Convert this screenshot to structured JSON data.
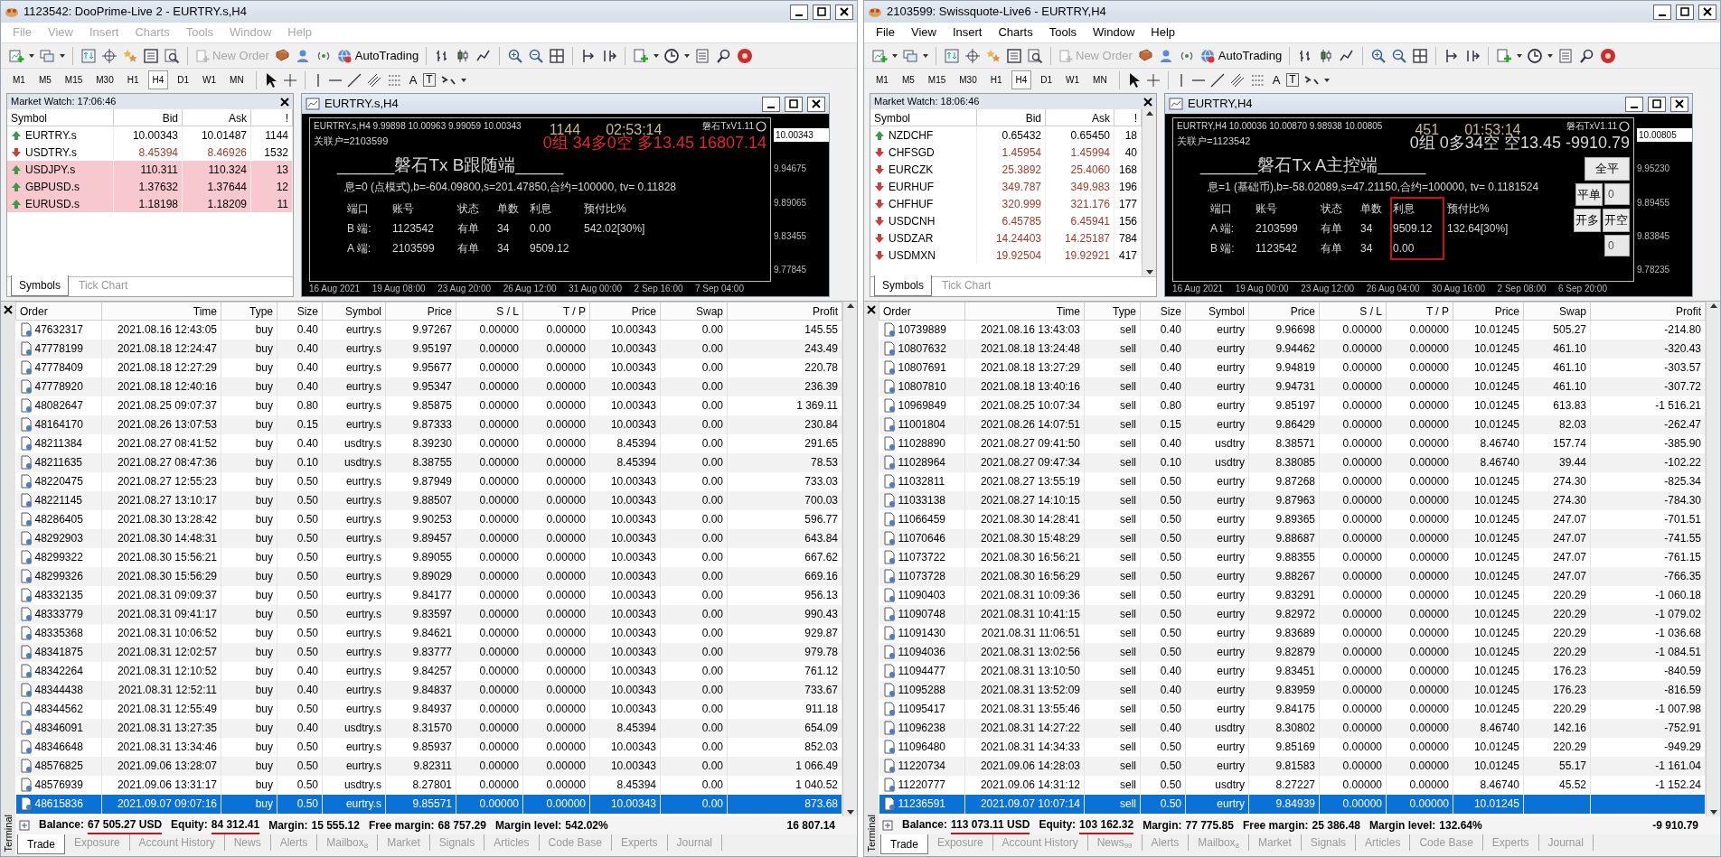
{
  "windows": [
    {
      "title": "1123542: DooPrime-Live 2 - EURTRY.s,H4",
      "active": false,
      "menu": [
        "File",
        "View",
        "Insert",
        "Charts",
        "Tools",
        "Window",
        "Help"
      ],
      "toolbar": {
        "new_order": {
          "label": "New Order",
          "disabled": true
        },
        "autotrading": "AutoTrading",
        "text_tool": "A",
        "label_tool": "T"
      },
      "timeframes": [
        {
          "label": "M1",
          "selected": false
        },
        {
          "label": "M5",
          "selected": false
        },
        {
          "label": "M15",
          "selected": false
        },
        {
          "label": "M30",
          "selected": false
        },
        {
          "label": "H1",
          "selected": false
        },
        {
          "label": "H4",
          "selected": true
        },
        {
          "label": "D1",
          "selected": false
        },
        {
          "label": "W1",
          "selected": false
        },
        {
          "label": "MN",
          "selected": false
        }
      ],
      "market_watch": {
        "title": "Market Watch: 17:06:46",
        "columns": [
          "Symbol",
          "Bid",
          "Ask",
          "!"
        ],
        "rows": [
          {
            "symbol": "EURTRY.s",
            "bid": "10.00343",
            "ask": "10.01487",
            "spread": "1144",
            "rising": true,
            "highlighted": false
          },
          {
            "symbol": "USDTRY.s",
            "bid": "8.45394",
            "ask": "8.46926",
            "spread": "1532",
            "rising": false,
            "highlighted": false
          },
          {
            "symbol": "USDJPY.s",
            "bid": "110.311",
            "ask": "110.324",
            "spread": "13",
            "rising": true,
            "highlighted": true
          },
          {
            "symbol": "GBPUSD.s",
            "bid": "1.37632",
            "ask": "1.37644",
            "spread": "12",
            "rising": true,
            "highlighted": true
          },
          {
            "symbol": "EURUSD.s",
            "bid": "1.18198",
            "ask": "1.18209",
            "spread": "11",
            "rising": true,
            "highlighted": true
          }
        ],
        "tabs": [
          {
            "label": "Symbols",
            "selected": true
          },
          {
            "label": "Tick Chart",
            "selected": false
          }
        ]
      },
      "chart": {
        "title": "EURTRY.s,H4",
        "ohlc": "EURTRY.s,H4  9.99898 10.00963 9.99059 10.00343",
        "linked": "关联户=2103599",
        "counter": "1144",
        "timer": "02:53:14",
        "version": "磐石TxV1.11",
        "summary": {
          "text": "0组 34多0空 多13.45 16807.14",
          "color": "#e0252d"
        },
        "panel": {
          "title": "______磐石Tx B跟随端_____",
          "info": "息=0 (点模式),b=-604.09800,s=201.47850,合约=100000, tv= 0.11828",
          "columns": [
            {
              "label": "端口",
              "boxed": false
            },
            {
              "label": "账号",
              "boxed": false
            },
            {
              "label": "状态",
              "boxed": false
            },
            {
              "label": "单数",
              "boxed": false
            },
            {
              "label": "利息",
              "boxed": false
            },
            {
              "label": "预付比%",
              "boxed": false
            }
          ],
          "rows": [
            [
              "B 端:",
              "1123542",
              "有单",
              "34",
              "0.00",
              "542.02[30%]"
            ],
            [
              "A 端:",
              "2103599",
              "有单",
              "34",
              "9509.12"
            ]
          ]
        },
        "price_scale": [
          {
            "label": "10.00343",
            "current": true
          },
          {
            "label": "9.94675",
            "current": false
          },
          {
            "label": "9.89065",
            "current": false
          },
          {
            "label": "9.83455",
            "current": false
          },
          {
            "label": "9.77845",
            "current": false
          }
        ],
        "time_axis": [
          "16 Aug 2021",
          "19 Aug 08:00",
          "23 Aug 20:00",
          "26 Aug 12:00",
          "31 Aug 00:00",
          "2 Sep 16:00",
          "7 Sep 04:00"
        ]
      },
      "terminal": {
        "label": "Terminal",
        "columns": [
          "Order",
          "Time",
          "Type",
          "Size",
          "Symbol",
          "Price",
          "S / L",
          "T / P",
          "Price",
          "Swap",
          "Profit"
        ],
        "rows": [
          {
            "cells": [
              "47632317",
              "2021.08.16 12:43:05",
              "buy",
              "0.40",
              "eurtry.s",
              "9.97267",
              "0.00000",
              "0.00000",
              "10.00343",
              "0.00",
              "145.55"
            ],
            "selected": false
          },
          {
            "cells": [
              "47778199",
              "2021.08.18 12:24:47",
              "buy",
              "0.40",
              "eurtry.s",
              "9.95197",
              "0.00000",
              "0.00000",
              "10.00343",
              "0.00",
              "243.49"
            ],
            "selected": false
          },
          {
            "cells": [
              "47778409",
              "2021.08.18 12:27:29",
              "buy",
              "0.40",
              "eurtry.s",
              "9.95677",
              "0.00000",
              "0.00000",
              "10.00343",
              "0.00",
              "220.78"
            ],
            "selected": false
          },
          {
            "cells": [
              "47778920",
              "2021.08.18 12:40:16",
              "buy",
              "0.40",
              "eurtry.s",
              "9.95347",
              "0.00000",
              "0.00000",
              "10.00343",
              "0.00",
              "236.39"
            ],
            "selected": false
          },
          {
            "cells": [
              "48082647",
              "2021.08.25 09:07:37",
              "buy",
              "0.80",
              "eurtry.s",
              "9.85875",
              "0.00000",
              "0.00000",
              "10.00343",
              "0.00",
              "1 369.11"
            ],
            "selected": false
          },
          {
            "cells": [
              "48164170",
              "2021.08.26 13:07:53",
              "buy",
              "0.15",
              "eurtry.s",
              "9.87333",
              "0.00000",
              "0.00000",
              "10.00343",
              "0.00",
              "230.84"
            ],
            "selected": false
          },
          {
            "cells": [
              "48211384",
              "2021.08.27 08:41:52",
              "buy",
              "0.40",
              "usdtry.s",
              "8.39230",
              "0.00000",
              "0.00000",
              "8.45394",
              "0.00",
              "291.65"
            ],
            "selected": false
          },
          {
            "cells": [
              "48211635",
              "2021.08.27 08:47:36",
              "buy",
              "0.10",
              "usdtry.s",
              "8.38755",
              "0.00000",
              "0.00000",
              "8.45394",
              "0.00",
              "78.53"
            ],
            "selected": false
          },
          {
            "cells": [
              "48220475",
              "2021.08.27 12:55:23",
              "buy",
              "0.50",
              "eurtry.s",
              "9.87949",
              "0.00000",
              "0.00000",
              "10.00343",
              "0.00",
              "733.03"
            ],
            "selected": false
          },
          {
            "cells": [
              "48221145",
              "2021.08.27 13:10:17",
              "buy",
              "0.50",
              "eurtry.s",
              "9.88507",
              "0.00000",
              "0.00000",
              "10.00343",
              "0.00",
              "700.03"
            ],
            "selected": false
          },
          {
            "cells": [
              "48286405",
              "2021.08.30 13:28:42",
              "buy",
              "0.50",
              "eurtry.s",
              "9.90253",
              "0.00000",
              "0.00000",
              "10.00343",
              "0.00",
              "596.77"
            ],
            "selected": false
          },
          {
            "cells": [
              "48292903",
              "2021.08.30 14:48:31",
              "buy",
              "0.50",
              "eurtry.s",
              "9.89457",
              "0.00000",
              "0.00000",
              "10.00343",
              "0.00",
              "643.84"
            ],
            "selected": false
          },
          {
            "cells": [
              "48299322",
              "2021.08.30 15:56:21",
              "buy",
              "0.50",
              "eurtry.s",
              "9.89055",
              "0.00000",
              "0.00000",
              "10.00343",
              "0.00",
              "667.62"
            ],
            "selected": false
          },
          {
            "cells": [
              "48299326",
              "2021.08.30 15:56:29",
              "buy",
              "0.50",
              "eurtry.s",
              "9.89029",
              "0.00000",
              "0.00000",
              "10.00343",
              "0.00",
              "669.16"
            ],
            "selected": false
          },
          {
            "cells": [
              "48332135",
              "2021.08.31 09:09:37",
              "buy",
              "0.50",
              "eurtry.s",
              "9.84177",
              "0.00000",
              "0.00000",
              "10.00343",
              "0.00",
              "956.13"
            ],
            "selected": false
          },
          {
            "cells": [
              "48333779",
              "2021.08.31 09:41:17",
              "buy",
              "0.50",
              "eurtry.s",
              "9.83597",
              "0.00000",
              "0.00000",
              "10.00343",
              "0.00",
              "990.43"
            ],
            "selected": false
          },
          {
            "cells": [
              "48335368",
              "2021.08.31 10:06:52",
              "buy",
              "0.50",
              "eurtry.s",
              "9.84621",
              "0.00000",
              "0.00000",
              "10.00343",
              "0.00",
              "929.87"
            ],
            "selected": false
          },
          {
            "cells": [
              "48341875",
              "2021.08.31 12:02:57",
              "buy",
              "0.50",
              "eurtry.s",
              "9.83777",
              "0.00000",
              "0.00000",
              "10.00343",
              "0.00",
              "979.78"
            ],
            "selected": false
          },
          {
            "cells": [
              "48342264",
              "2021.08.31 12:10:52",
              "buy",
              "0.40",
              "eurtry.s",
              "9.84257",
              "0.00000",
              "0.00000",
              "10.00343",
              "0.00",
              "761.12"
            ],
            "selected": false
          },
          {
            "cells": [
              "48344438",
              "2021.08.31 12:52:11",
              "buy",
              "0.40",
              "eurtry.s",
              "9.84837",
              "0.00000",
              "0.00000",
              "10.00343",
              "0.00",
              "733.67"
            ],
            "selected": false
          },
          {
            "cells": [
              "48344562",
              "2021.08.31 12:55:49",
              "buy",
              "0.50",
              "eurtry.s",
              "9.84937",
              "0.00000",
              "0.00000",
              "10.00343",
              "0.00",
              "911.18"
            ],
            "selected": false
          },
          {
            "cells": [
              "48346091",
              "2021.08.31 13:27:35",
              "buy",
              "0.40",
              "usdtry.s",
              "8.31570",
              "0.00000",
              "0.00000",
              "8.45394",
              "0.00",
              "654.09"
            ],
            "selected": false
          },
          {
            "cells": [
              "48346648",
              "2021.08.31 13:34:46",
              "buy",
              "0.50",
              "eurtry.s",
              "9.85937",
              "0.00000",
              "0.00000",
              "10.00343",
              "0.00",
              "852.03"
            ],
            "selected": false
          },
          {
            "cells": [
              "48576825",
              "2021.09.06 13:28:07",
              "buy",
              "0.50",
              "eurtry.s",
              "9.82311",
              "0.00000",
              "0.00000",
              "10.00343",
              "0.00",
              "1 066.49"
            ],
            "selected": false
          },
          {
            "cells": [
              "48576939",
              "2021.09.06 13:31:17",
              "buy",
              "0.50",
              "usdtry.s",
              "8.27801",
              "0.00000",
              "0.00000",
              "8.45394",
              "0.00",
              "1 040.52"
            ],
            "selected": false
          },
          {
            "cells": [
              "48615836",
              "2021.09.07 09:07:16",
              "buy",
              "0.50",
              "eurtry.s",
              "9.85571",
              "0.00000",
              "0.00000",
              "10.00343",
              "0.00",
              "873.68"
            ],
            "selected": true
          }
        ],
        "summary": [
          {
            "label": "Balance:",
            "value": "67 505.27 USD",
            "underlined": true
          },
          {
            "label": "Equity:",
            "value": "84 312.41",
            "underlined": true
          },
          {
            "label": "Margin:",
            "value": "15 555.12",
            "underlined": false
          },
          {
            "label": "Free margin:",
            "value": "68 757.29",
            "underlined": false
          },
          {
            "label": "Margin level:",
            "value": "542.02%",
            "underlined": false
          }
        ],
        "total": "16 807.14",
        "tabs": [
          {
            "label": "Trade",
            "selected": true
          },
          {
            "label": "Exposure",
            "selected": false
          },
          {
            "label": "Account History",
            "selected": false
          },
          {
            "label": "News",
            "selected": false
          },
          {
            "label": "Alerts",
            "selected": false
          },
          {
            "label": "Mailbox$_{8}$",
            "selected": false
          },
          {
            "label": "Market",
            "selected": false
          },
          {
            "label": "Signals",
            "selected": false
          },
          {
            "label": "Articles",
            "selected": false
          },
          {
            "label": "Code Base",
            "selected": false
          },
          {
            "label": "Experts",
            "selected": false
          },
          {
            "label": "Journal",
            "selected": false
          }
        ]
      }
    },
    {
      "title": "2103599: Swissquote-Live6 - EURTRY,H4",
      "active": true,
      "menu": [
        "File",
        "View",
        "Insert",
        "Charts",
        "Tools",
        "Window",
        "Help"
      ],
      "toolbar": {
        "new_order": {
          "label": "New Order",
          "disabled": true
        },
        "autotrading": "AutoTrading",
        "text_tool": "A",
        "label_tool": "T"
      },
      "timeframes": [
        {
          "label": "M1",
          "selected": false
        },
        {
          "label": "M5",
          "selected": false
        },
        {
          "label": "M15",
          "selected": false
        },
        {
          "label": "M30",
          "selected": false
        },
        {
          "label": "H1",
          "selected": false
        },
        {
          "label": "H4",
          "selected": true
        },
        {
          "label": "D1",
          "selected": false
        },
        {
          "label": "W1",
          "selected": false
        },
        {
          "label": "MN",
          "selected": false
        }
      ],
      "market_watch": {
        "title": "Market Watch: 18:06:46",
        "columns": [
          "Symbol",
          "Bid",
          "Ask",
          "!"
        ],
        "scrollbar": true,
        "rows": [
          {
            "symbol": "NZDCHF",
            "bid": "0.65432",
            "ask": "0.65450",
            "spread": "18",
            "rising": true,
            "highlighted": false
          },
          {
            "symbol": "CHFSGD",
            "bid": "1.45954",
            "ask": "1.45994",
            "spread": "40",
            "rising": false,
            "highlighted": false
          },
          {
            "symbol": "EURCZK",
            "bid": "25.3892",
            "ask": "25.4060",
            "spread": "168",
            "rising": false,
            "highlighted": false
          },
          {
            "symbol": "EURHUF",
            "bid": "349.787",
            "ask": "349.983",
            "spread": "196",
            "rising": false,
            "highlighted": false
          },
          {
            "symbol": "CHFHUF",
            "bid": "320.999",
            "ask": "321.176",
            "spread": "177",
            "rising": false,
            "highlighted": false
          },
          {
            "symbol": "USDCNH",
            "bid": "6.45785",
            "ask": "6.45941",
            "spread": "156",
            "rising": false,
            "highlighted": false
          },
          {
            "symbol": "USDZAR",
            "bid": "14.24403",
            "ask": "14.25187",
            "spread": "784",
            "rising": false,
            "highlighted": false
          },
          {
            "symbol": "USDMXN",
            "bid": "19.92504",
            "ask": "19.92921",
            "spread": "417",
            "rising": false,
            "highlighted": false
          }
        ],
        "tabs": [
          {
            "label": "Symbols",
            "selected": true
          },
          {
            "label": "Tick Chart",
            "selected": false
          }
        ]
      },
      "chart": {
        "title": "EURTRY,H4",
        "ohlc": "EURTRY,H4  10.00036 10.00870 9.98938 10.00805",
        "linked": "关联户=1123542",
        "counter": "451",
        "timer": "01:53:14",
        "version": "磐石TxV1.11",
        "summary": {
          "text": "0组 0多34空 空13.45 -9910.79",
          "color": "#d9d9d9"
        },
        "panel": {
          "title": "______磐石Tx A主控端_____",
          "info": "息=1 (基础币),b=-58.02089,s=47.21150,合约=100000, tv= 0.1181524",
          "columns": [
            {
              "label": "端口",
              "boxed": false
            },
            {
              "label": "账号",
              "boxed": false
            },
            {
              "label": "状态",
              "boxed": false
            },
            {
              "label": "单数",
              "boxed": false
            },
            {
              "label": "利息",
              "boxed": true
            },
            {
              "label": "预付比%",
              "boxed": false
            }
          ],
          "rows": [
            [
              "A 端:",
              "2103599",
              "有单",
              "34",
              "9509.12",
              "132.64[30%]"
            ],
            [
              "B 端:",
              "1123542",
              "有单",
              "34",
              "0.00"
            ]
          ]
        },
        "controls": [
          [
            {
              "kind": "button",
              "label": "全平"
            }
          ],
          [
            {
              "kind": "button",
              "label": "平单"
            },
            {
              "kind": "field",
              "value": "0"
            }
          ],
          [
            {
              "kind": "button",
              "label": "开多"
            },
            {
              "kind": "button",
              "label": "开空"
            }
          ],
          [
            {
              "kind": "field",
              "value": "0"
            }
          ]
        ],
        "price_scale": [
          {
            "label": "10.00805",
            "current": true
          },
          {
            "label": "9.95230",
            "current": false
          },
          {
            "label": "9.89455",
            "current": false
          },
          {
            "label": "9.83845",
            "current": false
          },
          {
            "label": "9.78235",
            "current": false
          }
        ],
        "time_axis": [
          "16 Aug 2021",
          "19 Aug 00:00",
          "23 Aug 12:00",
          "26 Aug 04:00",
          "30 Aug 16:00",
          "2 Sep 08:00",
          "6 Sep 20:00"
        ]
      },
      "terminal": {
        "label": "Terminal",
        "columns": [
          "Order",
          "Time",
          "Type",
          "Size",
          "Symbol",
          "Price",
          "S / L",
          "T / P",
          "Price",
          "Swap",
          "Profit"
        ],
        "rows": [
          {
            "cells": [
              "10739889",
              "2021.08.16 13:43:03",
              "sell",
              "0.40",
              "eurtry",
              "9.96698",
              "0.00000",
              "0.00000",
              "10.01245",
              "505.27",
              "-214.80"
            ],
            "selected": false
          },
          {
            "cells": [
              "10807632",
              "2021.08.18 13:24:48",
              "sell",
              "0.40",
              "eurtry",
              "9.94462",
              "0.00000",
              "0.00000",
              "10.01245",
              "461.10",
              "-320.43"
            ],
            "selected": false
          },
          {
            "cells": [
              "10807691",
              "2021.08.18 13:27:29",
              "sell",
              "0.40",
              "eurtry",
              "9.94819",
              "0.00000",
              "0.00000",
              "10.01245",
              "461.10",
              "-303.57"
            ],
            "selected": false
          },
          {
            "cells": [
              "10807810",
              "2021.08.18 13:40:16",
              "sell",
              "0.40",
              "eurtry",
              "9.94731",
              "0.00000",
              "0.00000",
              "10.01245",
              "461.10",
              "-307.72"
            ],
            "selected": false
          },
          {
            "cells": [
              "10969849",
              "2021.08.25 10:07:34",
              "sell",
              "0.80",
              "eurtry",
              "9.85197",
              "0.00000",
              "0.00000",
              "10.01245",
              "613.83",
              "-1 516.21"
            ],
            "selected": false
          },
          {
            "cells": [
              "11001804",
              "2021.08.26 14:07:51",
              "sell",
              "0.15",
              "eurtry",
              "9.86429",
              "0.00000",
              "0.00000",
              "10.01245",
              "82.03",
              "-262.47"
            ],
            "selected": false
          },
          {
            "cells": [
              "11028890",
              "2021.08.27 09:41:50",
              "sell",
              "0.40",
              "usdtry",
              "8.38571",
              "0.00000",
              "0.00000",
              "8.46740",
              "157.74",
              "-385.90"
            ],
            "selected": false
          },
          {
            "cells": [
              "11028964",
              "2021.08.27 09:47:34",
              "sell",
              "0.10",
              "usdtry",
              "8.38085",
              "0.00000",
              "0.00000",
              "8.46740",
              "39.44",
              "-102.22"
            ],
            "selected": false
          },
          {
            "cells": [
              "11032811",
              "2021.08.27 13:55:19",
              "sell",
              "0.50",
              "eurtry",
              "9.87268",
              "0.00000",
              "0.00000",
              "10.01245",
              "274.30",
              "-825.34"
            ],
            "selected": false
          },
          {
            "cells": [
              "11033138",
              "2021.08.27 14:10:15",
              "sell",
              "0.50",
              "eurtry",
              "9.87963",
              "0.00000",
              "0.00000",
              "10.01245",
              "274.30",
              "-784.30"
            ],
            "selected": false
          },
          {
            "cells": [
              "11066459",
              "2021.08.30 14:28:41",
              "sell",
              "0.50",
              "eurtry",
              "9.89365",
              "0.00000",
              "0.00000",
              "10.01245",
              "247.07",
              "-701.51"
            ],
            "selected": false
          },
          {
            "cells": [
              "11070646",
              "2021.08.30 15:48:29",
              "sell",
              "0.50",
              "eurtry",
              "9.88687",
              "0.00000",
              "0.00000",
              "10.01245",
              "247.07",
              "-741.55"
            ],
            "selected": false
          },
          {
            "cells": [
              "11073722",
              "2021.08.30 16:56:21",
              "sell",
              "0.50",
              "eurtry",
              "9.88355",
              "0.00000",
              "0.00000",
              "10.01245",
              "247.07",
              "-761.15"
            ],
            "selected": false
          },
          {
            "cells": [
              "11073728",
              "2021.08.30 16:56:29",
              "sell",
              "0.50",
              "eurtry",
              "9.88267",
              "0.00000",
              "0.00000",
              "10.01245",
              "247.07",
              "-766.35"
            ],
            "selected": false
          },
          {
            "cells": [
              "11090403",
              "2021.08.31 10:09:36",
              "sell",
              "0.50",
              "eurtry",
              "9.83291",
              "0.00000",
              "0.00000",
              "10.01245",
              "220.29",
              "-1 060.18"
            ],
            "selected": false
          },
          {
            "cells": [
              "11090748",
              "2021.08.31 10:41:15",
              "sell",
              "0.50",
              "eurtry",
              "9.82972",
              "0.00000",
              "0.00000",
              "10.01245",
              "220.29",
              "-1 079.02"
            ],
            "selected": false
          },
          {
            "cells": [
              "11091430",
              "2021.08.31 11:06:51",
              "sell",
              "0.50",
              "eurtry",
              "9.83689",
              "0.00000",
              "0.00000",
              "10.01245",
              "220.29",
              "-1 036.68"
            ],
            "selected": false
          },
          {
            "cells": [
              "11094036",
              "2021.08.31 13:02:56",
              "sell",
              "0.50",
              "eurtry",
              "9.82879",
              "0.00000",
              "0.00000",
              "10.01245",
              "220.29",
              "-1 084.51"
            ],
            "selected": false
          },
          {
            "cells": [
              "11094477",
              "2021.08.31 13:10:50",
              "sell",
              "0.40",
              "eurtry",
              "9.83451",
              "0.00000",
              "0.00000",
              "10.01245",
              "176.23",
              "-840.59"
            ],
            "selected": false
          },
          {
            "cells": [
              "11095288",
              "2021.08.31 13:52:09",
              "sell",
              "0.40",
              "eurtry",
              "9.83959",
              "0.00000",
              "0.00000",
              "10.01245",
              "176.23",
              "-816.59"
            ],
            "selected": false
          },
          {
            "cells": [
              "11095417",
              "2021.08.31 13:55:46",
              "sell",
              "0.50",
              "eurtry",
              "9.84175",
              "0.00000",
              "0.00000",
              "10.01245",
              "220.29",
              "-1 007.98"
            ],
            "selected": false
          },
          {
            "cells": [
              "11096238",
              "2021.08.31 14:27:22",
              "sell",
              "0.40",
              "usdtry",
              "8.30802",
              "0.00000",
              "0.00000",
              "8.46740",
              "142.16",
              "-752.91"
            ],
            "selected": false
          },
          {
            "cells": [
              "11096480",
              "2021.08.31 14:34:33",
              "sell",
              "0.50",
              "eurtry",
              "9.85169",
              "0.00000",
              "0.00000",
              "10.01245",
              "220.29",
              "-949.29"
            ],
            "selected": false
          },
          {
            "cells": [
              "11220734",
              "2021.09.06 14:28:03",
              "sell",
              "0.50",
              "eurtry",
              "9.81583",
              "0.00000",
              "0.00000",
              "10.01245",
              "55.17",
              "-1 161.04"
            ],
            "selected": false
          },
          {
            "cells": [
              "11220777",
              "2021.09.06 14:31:12",
              "sell",
              "0.50",
              "usdtry",
              "8.27227",
              "0.00000",
              "0.00000",
              "8.46740",
              "45.52",
              "-1 152.24"
            ],
            "selected": false
          },
          {
            "cells": [
              "11236591",
              "2021.09.07 10:07:14",
              "sell",
              "0.50",
              "eurtry",
              "9.84939",
              "0.00000",
              "0.00000",
              "10.01245"
            ],
            "selected": true
          }
        ],
        "summary": [
          {
            "label": "Balance:",
            "value": "113 073.11 USD",
            "underlined": true
          },
          {
            "label": "Equity:",
            "value": "103 162.32",
            "underlined": true
          },
          {
            "label": "Margin:",
            "value": "77 775.85",
            "underlined": false
          },
          {
            "label": "Free margin:",
            "value": "25 386.48",
            "underlined": false
          },
          {
            "label": "Margin level:",
            "value": "132.64%",
            "underlined": false
          }
        ],
        "total": "-9 910.79",
        "tabs": [
          {
            "label": "Trade",
            "selected": true
          },
          {
            "label": "Exposure",
            "selected": false
          },
          {
            "label": "Account History",
            "selected": false
          },
          {
            "label": "News$_{99}$",
            "selected": false
          },
          {
            "label": "Alerts",
            "selected": false
          },
          {
            "label": "Mailbox$_{8}$",
            "selected": false
          },
          {
            "label": "Market",
            "selected": false
          },
          {
            "label": "Signals",
            "selected": false
          },
          {
            "label": "Articles",
            "selected": false
          },
          {
            "label": "Code Base",
            "selected": false
          },
          {
            "label": "Experts",
            "selected": false
          },
          {
            "label": "Journal",
            "selected": false
          }
        ]
      }
    }
  ]
}
